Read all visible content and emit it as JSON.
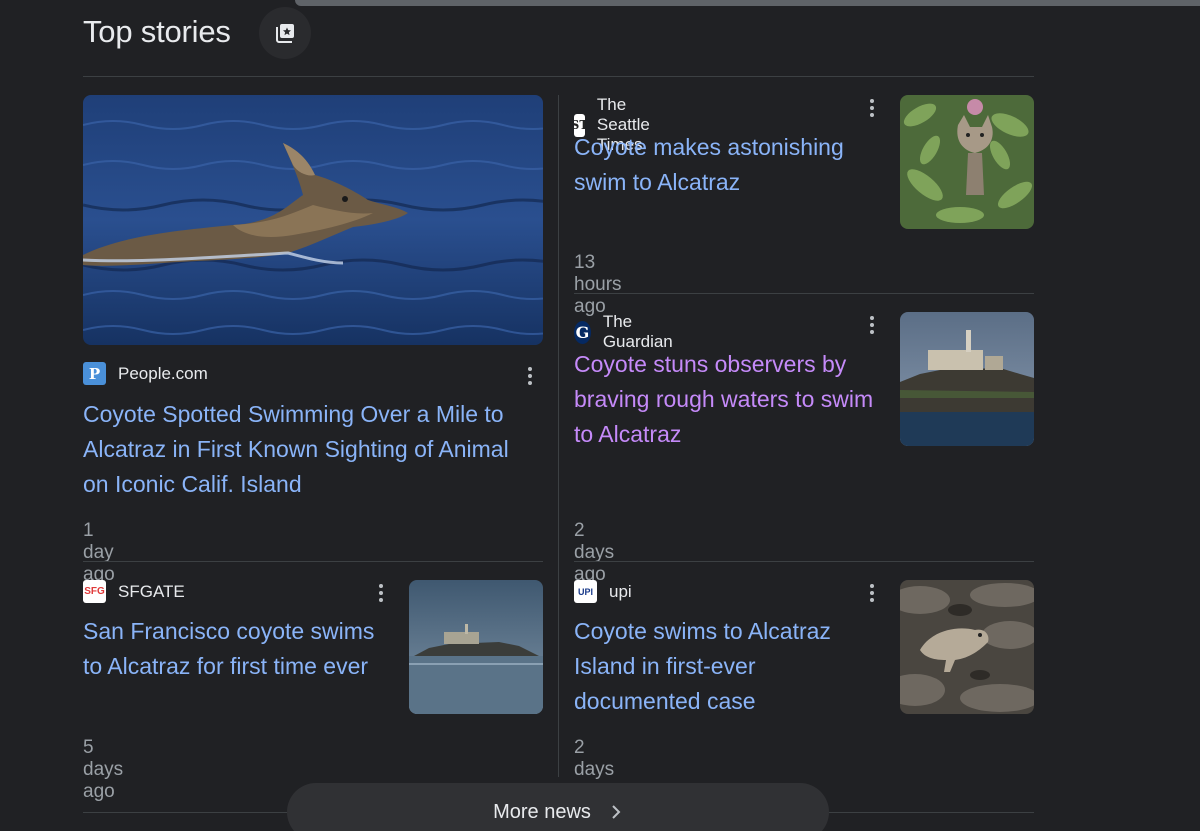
{
  "section": {
    "title": "Top stories",
    "icon": "add-to-collection-icon"
  },
  "stories": [
    {
      "source": "People.com",
      "favicon_text": "P",
      "headline": "Coyote Spotted Swimming Over a Mile to Alcatraz in First Known Sighting of Animal on Iconic Calif. Island",
      "time": "1 day ago",
      "image": "coyote-swimming-photo"
    },
    {
      "source": "The Seattle Times",
      "favicon_text": "ST",
      "headline": "Coyote makes astonishing swim to Alcatraz",
      "time": "13 hours ago",
      "image": "coyote-in-foliage-photo"
    },
    {
      "source": "The Guardian",
      "favicon_text": "G",
      "headline": "Coyote stuns observers by braving rough waters to swim to Alcatraz",
      "time": "2 days ago",
      "image": "alcatraz-island-photo",
      "visited": true
    },
    {
      "source": "SFGATE",
      "favicon_text": "SFG",
      "headline": "San Francisco coyote swims to Alcatraz for first time ever",
      "time": "5 days ago",
      "image": "alcatraz-distance-photo"
    },
    {
      "source": "upi",
      "favicon_text": "UPI",
      "headline": "Coyote swims to Alcatraz Island in first-ever documented case",
      "time": "2 days ago",
      "image": "coyote-on-rocks-photo"
    }
  ],
  "more_news": {
    "label": "More news",
    "icon": "chevron-right-icon"
  },
  "colors": {
    "background": "#202124",
    "link": "#8ab4f8",
    "visited_link": "#c58af9",
    "muted": "#9aa0a6"
  }
}
